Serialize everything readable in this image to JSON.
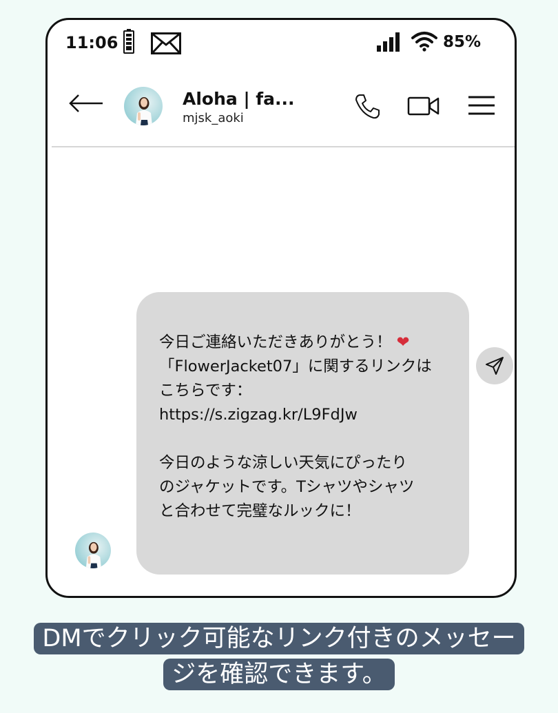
{
  "status_bar": {
    "time": "11:06",
    "battery_percent": "85%",
    "icons": [
      "battery-icon",
      "mail-icon",
      "signal-icon",
      "wifi-icon"
    ]
  },
  "header": {
    "name": "Aloha | fa...",
    "handle": "mjsk_aoki",
    "icons": [
      "back-arrow-icon",
      "phone-icon",
      "video-camera-icon",
      "menu-icon"
    ]
  },
  "message": {
    "line1": "今日ご連絡いただきありがとう！",
    "heart": "❤",
    "line2": "「FlowerJacket07」に関するリンクは",
    "line3": "こちらです：",
    "link": "https://s.zigzag.kr/L9FdJw",
    "line4": "今日のような涼しい天気にぴったり",
    "line5": "のジャケットです。Tシャツやシャツ",
    "line6": "と合わせて完璧なルックに！"
  },
  "caption": {
    "line1": "DMでクリック可能なリンク付きのメッセー",
    "line2": "ジを確認できます。"
  },
  "colors": {
    "background": "#f1fbf8",
    "bubble": "#d9d9d9",
    "caption_bg": "#4a5b70",
    "heart": "#d62d3a",
    "avatar_accent": "#9ed2d8"
  }
}
